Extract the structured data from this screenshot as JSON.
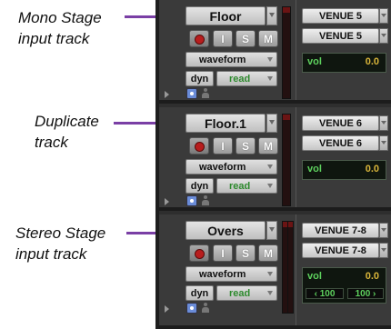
{
  "annotations": [
    {
      "line1": "Mono Stage",
      "line2": "input track"
    },
    {
      "line1": "Duplicate",
      "line2": "track"
    },
    {
      "line1": "Stereo Stage",
      "line2": "input track"
    }
  ],
  "colors": {
    "arrow": "#7a3fa5",
    "record": "#b81d1d",
    "vol_label": "#5ed25e",
    "vol_value": "#d9b53a",
    "automation": "#2e8a2e"
  },
  "tracks": [
    {
      "name": "Floor",
      "buttons": {
        "input": "I",
        "solo": "S",
        "mute": "M"
      },
      "playlist": "waveform",
      "dyn": "dyn",
      "automation": "read",
      "outputs": [
        "VENUE 5",
        "VENUE 5"
      ],
      "vol_label": "vol",
      "vol_value": "0.0"
    },
    {
      "name": "Floor.1",
      "buttons": {
        "input": "I",
        "solo": "S",
        "mute": "M"
      },
      "playlist": "waveform",
      "dyn": "dyn",
      "automation": "read",
      "outputs": [
        "VENUE 6",
        "VENUE 6"
      ],
      "vol_label": "vol",
      "vol_value": "0.0"
    },
    {
      "name": "Overs",
      "buttons": {
        "input": "I",
        "solo": "S",
        "mute": "M"
      },
      "playlist": "waveform",
      "dyn": "dyn",
      "automation": "read",
      "outputs": [
        "VENUE 7-8",
        "VENUE 7-8"
      ],
      "vol_label": "vol",
      "vol_value": "0.0",
      "pan_left": "‹ 100",
      "pan_right": "100 ›"
    }
  ]
}
